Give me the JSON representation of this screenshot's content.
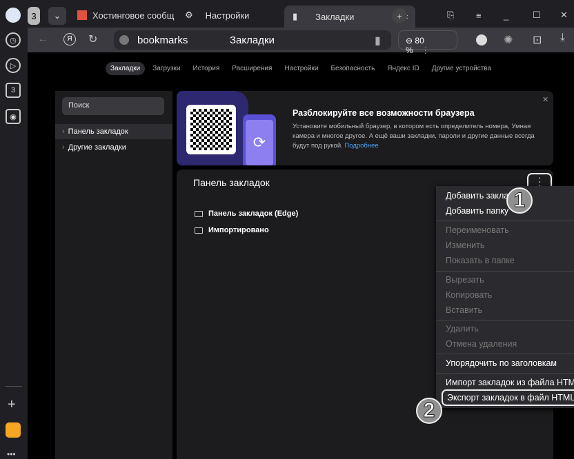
{
  "tabs": {
    "count": "3",
    "tab1": "Хостинговое сообщ",
    "tab2": "Настройки",
    "tab3": "Закладки"
  },
  "address": {
    "host": "bookmarks",
    "title": "Закладки",
    "zoom": "80 %"
  },
  "sidebar": {
    "tab_count": "3"
  },
  "nav": [
    "Закладки",
    "Загрузки",
    "История",
    "Расширения",
    "Настройки",
    "Безопасность",
    "Яндекс ID",
    "Другие устройства"
  ],
  "left": {
    "search_placeholder": "Поиск",
    "items": [
      "Панель закладок",
      "Другие закладки"
    ]
  },
  "promo": {
    "title": "Разблокируйте все возможности браузера",
    "text": "Установите мобильный браузер, в котором есть определитель номера, Умная камера и многое другое. А ещё ваши закладки, пароли и другие данные всегда будут под рукой.",
    "link": "Подробнее"
  },
  "main": {
    "title": "Панель закладок",
    "folders": [
      "Панель закладок (Edge)",
      "Импортировано"
    ]
  },
  "menu": [
    "Добавить закладку",
    "Добавить папку",
    "Переименовать",
    "Изменить",
    "Показать в папке",
    "Вырезать",
    "Копировать",
    "Вставить",
    "Удалить",
    "Отмена удаления",
    "Упорядочить по заголовкам",
    "Импорт закладок из файла HTML",
    "Экспорт закладок в файл HTML"
  ],
  "badges": [
    "1",
    "2"
  ]
}
